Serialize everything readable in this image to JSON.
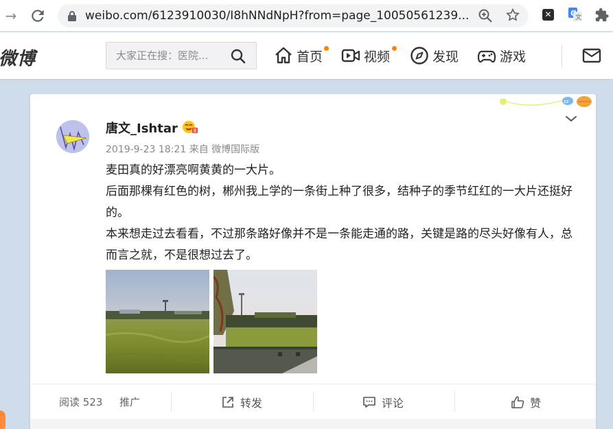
{
  "browser": {
    "url": "weibo.com/6123910030/I8hNNdNpH?from=page_10050561239...",
    "icons": [
      "back-arrow-icon",
      "reload-icon",
      "lock-icon",
      "zoom-icon",
      "star-icon",
      "x-extension-icon",
      "translate-extension-icon",
      "puzzle-extension-icon"
    ]
  },
  "header": {
    "logo": "微博",
    "search_placeholder": "大家正在搜：医院...",
    "nav": [
      {
        "label": "首页",
        "icon": "home-icon",
        "dot": true
      },
      {
        "label": "视频",
        "icon": "video-icon",
        "dot": true
      },
      {
        "label": "发现",
        "icon": "compass-icon",
        "dot": false
      },
      {
        "label": "游戏",
        "icon": "gamepad-icon",
        "dot": false
      }
    ],
    "mail_icon": "mail-icon",
    "accent": "#ff8200"
  },
  "post": {
    "username": "唐文_Ishtar",
    "meta": "2019-9-23 18:21 来自 微博国际版",
    "paragraphs": [
      "麦田真的好漂亮啊黄黄的一大片。",
      "后面那棵有红色的树，郴州我上学的一条街上种了很多，结种子的季节红红的一大片还挺好的。",
      "本来想走过去看看，不过那条路好像并不是一条能走通的路，关键是路的尽头好像有人，总而言之就，不是很想过去了。"
    ],
    "images": [
      "wheat-field-photo",
      "road-field-photo"
    ]
  },
  "actions": {
    "read": "阅读 523",
    "promote": "推广",
    "repost": "转发",
    "comment": "评论",
    "like": "赞"
  }
}
